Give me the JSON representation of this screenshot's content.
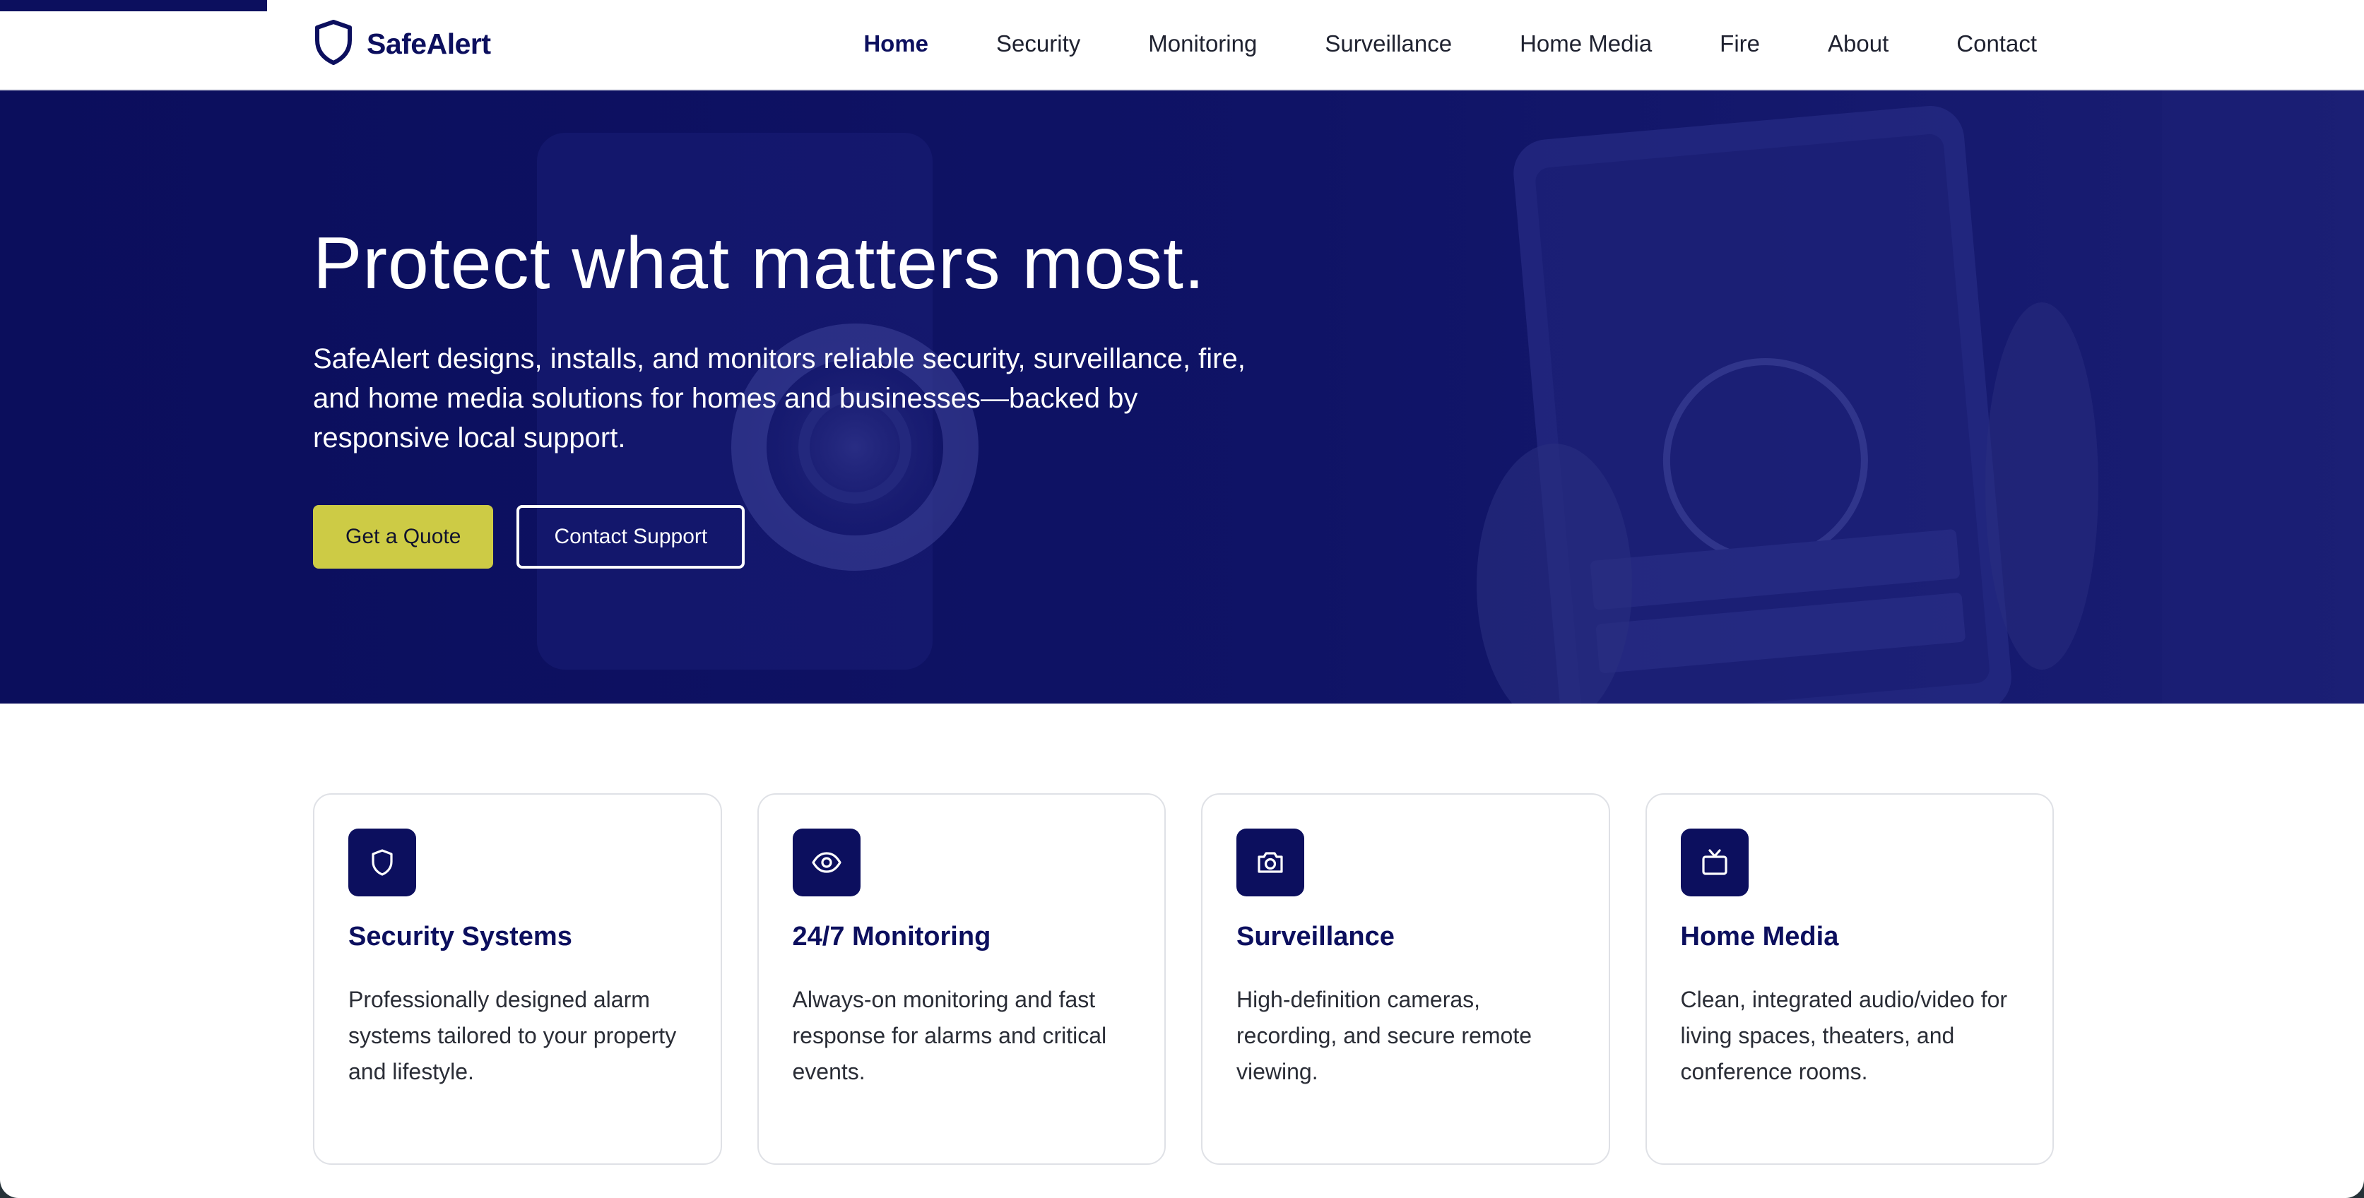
{
  "colors": {
    "brand_navy": "#0c0f5e",
    "accent_yellow": "#cdcb45",
    "hero_overlay": "#0f1366",
    "text_dark": "#1f2230"
  },
  "header": {
    "brand_name": "SafeAlert",
    "brand_icon": "shield-icon",
    "nav": [
      {
        "label": "Home",
        "active": true
      },
      {
        "label": "Security",
        "active": false
      },
      {
        "label": "Monitoring",
        "active": false
      },
      {
        "label": "Surveillance",
        "active": false
      },
      {
        "label": "Home Media",
        "active": false
      },
      {
        "label": "Fire",
        "active": false
      },
      {
        "label": "About",
        "active": false
      },
      {
        "label": "Contact",
        "active": false
      }
    ]
  },
  "hero": {
    "title": "Protect what matters most.",
    "subtitle": "SafeAlert designs, installs, and monitors reliable security, surveillance, fire, and home media solutions for homes and businesses—backed by responsive local support.",
    "primary_button": "Get a Quote",
    "secondary_button": "Contact Support"
  },
  "features": [
    {
      "icon": "shield-icon",
      "title": "Security Systems",
      "text": "Professionally designed alarm systems tailored to your property and lifestyle."
    },
    {
      "icon": "eye-icon",
      "title": "24/7 Monitoring",
      "text": "Always-on monitoring and fast response for alarms and critical events."
    },
    {
      "icon": "camera-icon",
      "title": "Surveillance",
      "text": "High-definition cameras, recording, and secure remote viewing."
    },
    {
      "icon": "tv-icon",
      "title": "Home Media",
      "text": "Clean, integrated audio/video for living spaces, theaters, and conference rooms."
    }
  ]
}
